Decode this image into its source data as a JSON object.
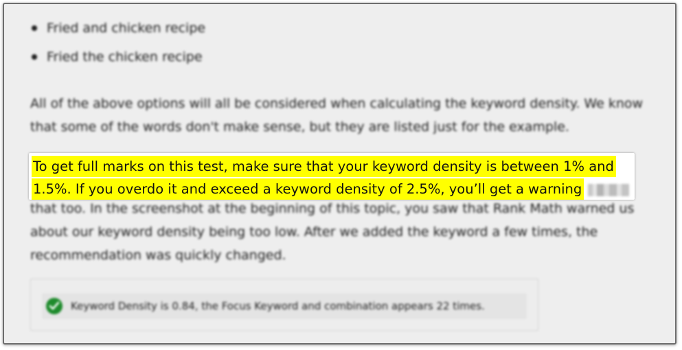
{
  "bullets": [
    "Fried and chicken recipe",
    "Fried the chicken recipe"
  ],
  "paragraph1": "All of the above options will all be considered when calculating the keyword density. We know that some of the words don't make sense, but they are listed just for the example.",
  "highlight": {
    "line1": "To get full marks on this test, make sure that your keyword density is between 1% and",
    "line2": "1.5%. If you overdo it and exceed a keyword density of 2.5%, you’ll get a warning"
  },
  "paragraph2_rest": "that too. In the screenshot at the beginning of this topic, you saw that Rank Math warned us about our keyword density being too low. After we added the keyword a few times, the recommendation was quickly changed.",
  "notice": {
    "icon": "check-circle-icon",
    "icon_color": "#1e8b2c",
    "text": "Keyword Density is 0.84, the Focus Keyword and combination appears 22 times."
  },
  "colors": {
    "highlight": "#ffff00",
    "background_dimmed": "#eeeeee"
  }
}
